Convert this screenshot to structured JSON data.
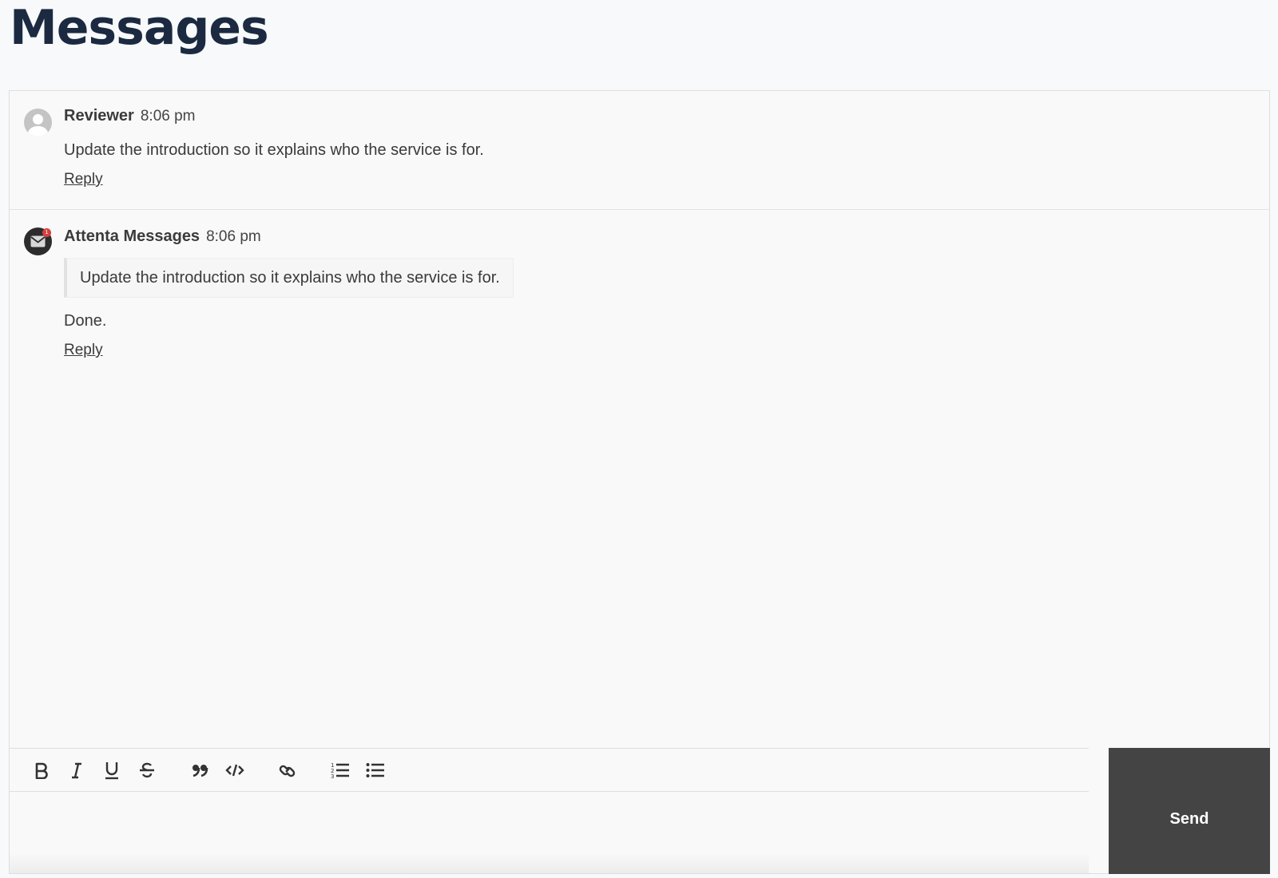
{
  "page": {
    "title": "Messages"
  },
  "thread": {
    "messages": [
      {
        "author": "Reviewer",
        "time": "8:06 pm",
        "text": "Update the introduction so it explains who the service is for.",
        "reply_label": "Reply"
      },
      {
        "author": "Attenta Messages",
        "time": "8:06 pm",
        "quote": "Update the introduction so it explains who the service is for.",
        "text": "Done.",
        "reply_label": "Reply",
        "notification_count": "1"
      }
    ]
  },
  "composer": {
    "toolbar": [
      {
        "name": "bold",
        "icon": "bold-icon"
      },
      {
        "name": "italic",
        "icon": "italic-icon"
      },
      {
        "name": "underline",
        "icon": "underline-icon"
      },
      {
        "name": "strikethrough",
        "icon": "strikethrough-icon"
      },
      {
        "name": "blockquote",
        "icon": "quote-icon"
      },
      {
        "name": "code",
        "icon": "code-icon"
      },
      {
        "name": "link",
        "icon": "link-icon"
      },
      {
        "name": "ordered-list",
        "icon": "ordered-list-icon"
      },
      {
        "name": "bullet-list",
        "icon": "bullet-list-icon"
      }
    ],
    "editor_value": "",
    "send_label": "Send"
  },
  "colors": {
    "title": "#1b2a40",
    "send_button": "#444444",
    "notification": "#d63f3f"
  }
}
